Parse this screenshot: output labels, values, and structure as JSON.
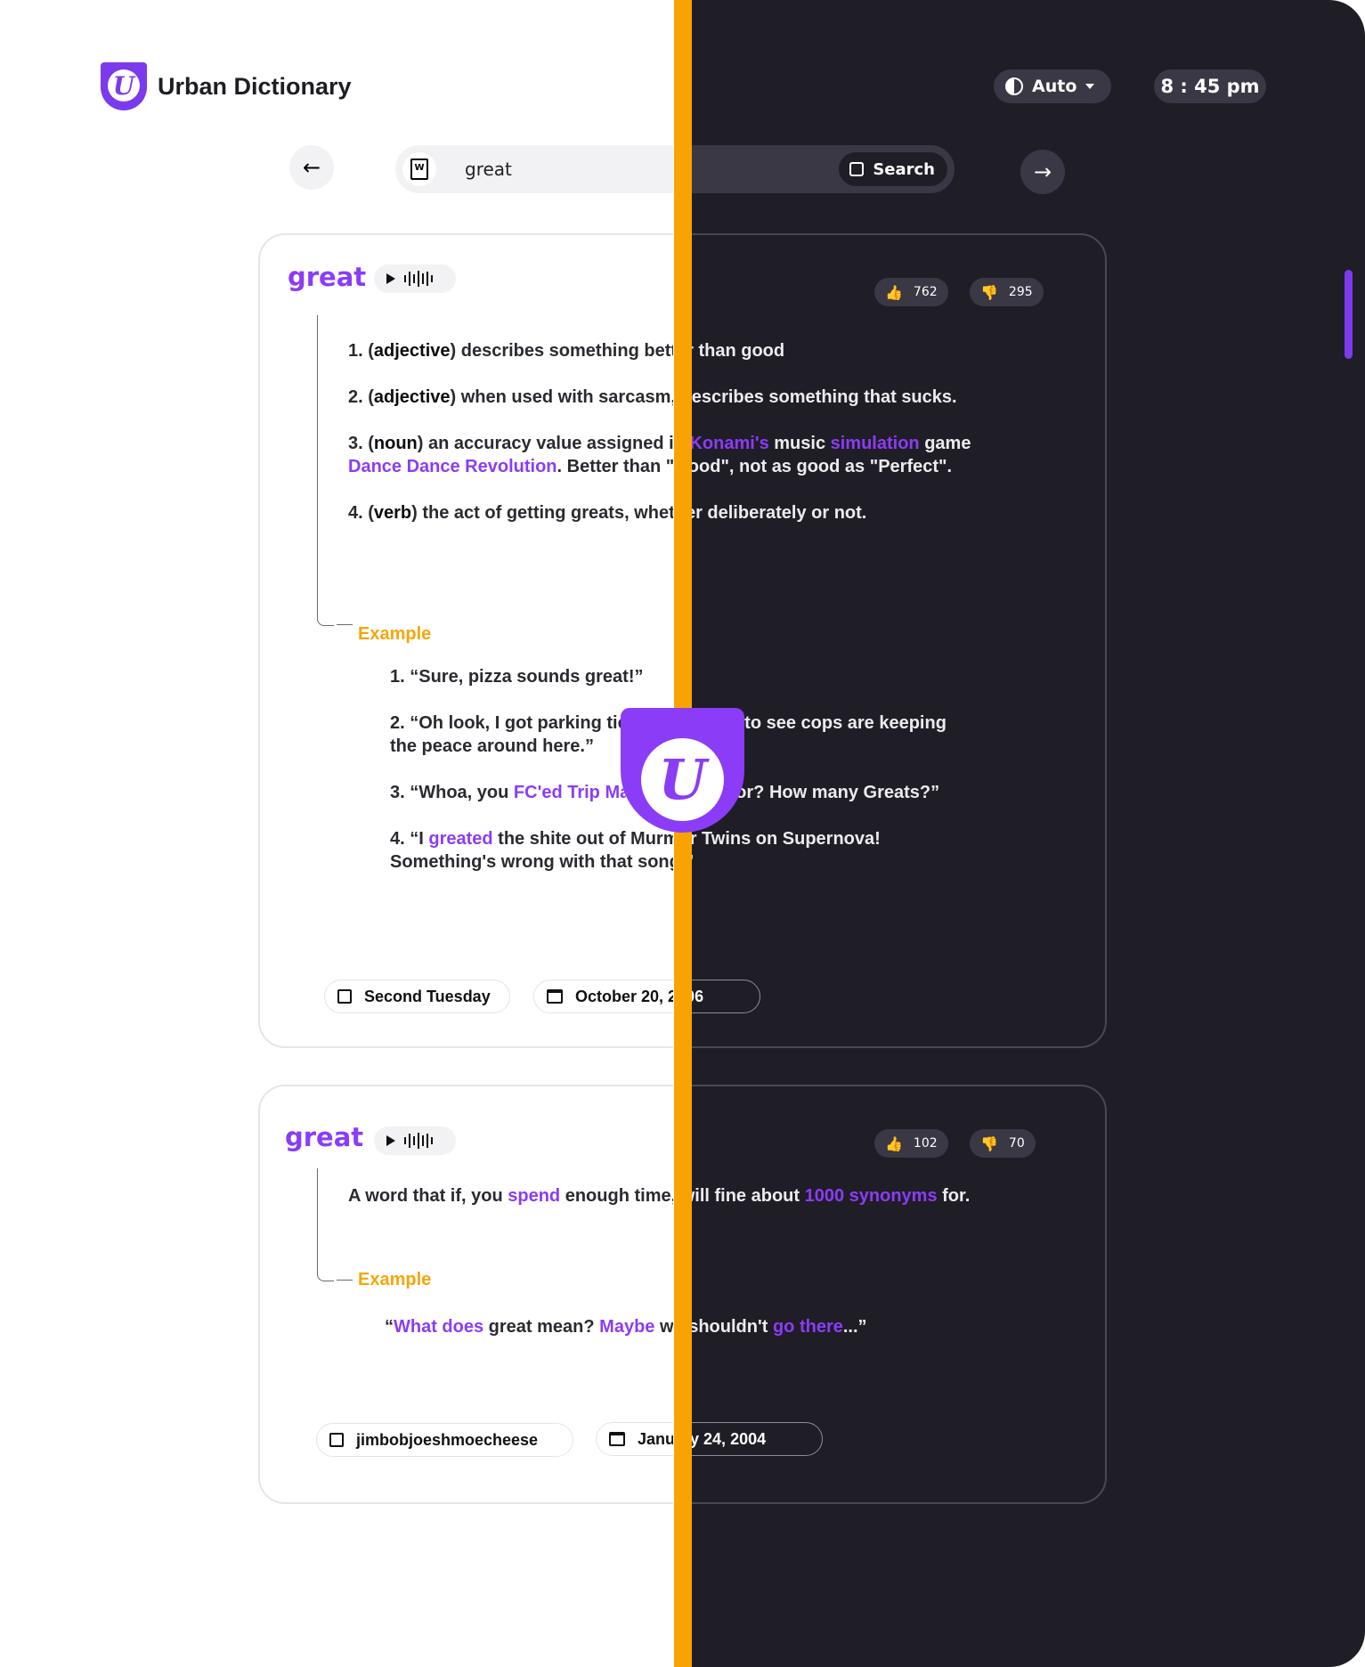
{
  "app": {
    "name": "Urban Dictionary",
    "logo_letter": "U",
    "accent": "#8b3cf7",
    "example_color": "#f5a60a",
    "divider_color": "#f9a300"
  },
  "header": {
    "theme_label": "Auto",
    "time": "8 : 45 pm"
  },
  "search": {
    "query": "great",
    "button_label": "Search"
  },
  "icons": {
    "back": "arrow-left-icon",
    "forward": "arrow-right-icon",
    "doc": "word-doc-icon",
    "theme": "half-moon-icon"
  },
  "entries": [
    {
      "word": "great",
      "upvotes": "762",
      "downvotes": "295",
      "definition": [
        [
          "1. (",
          "adjective",
          ") describes something better than good"
        ],
        [
          "2. (",
          "adjective",
          ") when used with sarcasm, describes something that sucks."
        ],
        [
          "3. (",
          "noun",
          ") an accuracy value assigned in ",
          "Konami's",
          " music ",
          "simulation",
          " game ",
          "Dance Dance Revolution",
          ".  Better than \"Good\", not as good as \"Perfect\"."
        ],
        [
          "4. (",
          "verb",
          ") the act of getting greats, whether deliberately or not."
        ]
      ],
      "example_label": "Example",
      "examples": [
        [
          "1. “Sure, pizza sounds great!”"
        ],
        [
          "2. “Oh look, I got parking tickets.  I'm glad to see cops are keeping the peace around here.”"
        ],
        [
          "3. “Whoa, you ",
          "FC'ed Trip Machine",
          " Survivor?  How many Greats?”"
        ],
        [
          "4. “I ",
          "greated",
          " the shite out of Murmur Twins on Supernova! Something's wrong with that song.”"
        ]
      ],
      "author": "Second Tuesday",
      "date": "October 20, 2006"
    },
    {
      "word": "great",
      "upvotes": "102",
      "downvotes": "70",
      "definition": [
        [
          "A word that if, you ",
          "spend",
          " enough time, will fine about ",
          "1000 synonyms",
          " for."
        ]
      ],
      "example_label": "Example",
      "examples": [
        [
          "“",
          "What does",
          " great mean? ",
          "Maybe",
          " we shouldn't  ",
          "go there",
          "...”"
        ]
      ],
      "author": "jimbobjoeshmoecheese",
      "date": "January 24, 2004"
    }
  ]
}
